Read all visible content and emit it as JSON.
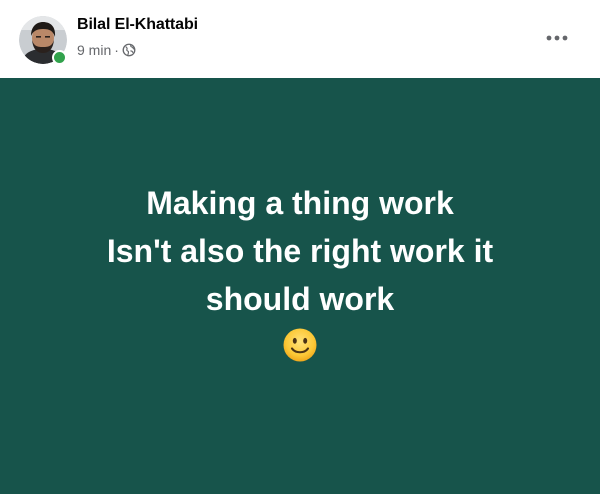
{
  "post": {
    "author_name": "Bilal El-Khattabi",
    "time_ago": "9 min",
    "separator": "·",
    "audience_icon": "globe-icon",
    "online": true,
    "more_icon": "more-horizontal-icon",
    "background_color": "#17544B",
    "text_color": "#ffffff",
    "text_lines": [
      "Making a thing work",
      "Isn't also the right work it",
      "should work"
    ],
    "emoji": "slightly-smiling-face-icon"
  }
}
